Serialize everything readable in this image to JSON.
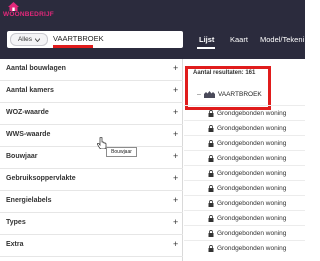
{
  "header": {
    "logo_text": "WOONBEDRIJF",
    "brand_color": "#e2287a"
  },
  "search": {
    "scope_label": "Alles",
    "query": "VAARTBROEK"
  },
  "tabs": [
    {
      "label": "Lijst",
      "active": true
    },
    {
      "label": "Kaart",
      "active": false
    },
    {
      "label": "Model/Tekeni",
      "active": false
    }
  ],
  "filters": [
    {
      "label": "Aantal bouwlagen",
      "icon": "plus-icon"
    },
    {
      "label": "Aantal kamers",
      "icon": "plus-icon"
    },
    {
      "label": "WOZ-waarde",
      "icon": "plus-icon"
    },
    {
      "label": "WWS-waarde",
      "icon": "plus-icon"
    },
    {
      "label": "Bouwjaar",
      "icon": "plus-icon"
    },
    {
      "label": "Gebruiksoppervlakte",
      "icon": "plus-icon"
    },
    {
      "label": "Energielabels",
      "icon": "plus-icon"
    },
    {
      "label": "Types",
      "icon": "plus-icon"
    },
    {
      "label": "Extra",
      "icon": "plus-icon"
    }
  ],
  "tooltip": "Bouwjaar",
  "results": {
    "count_label": "Aantal resultaten: 161",
    "group": {
      "toggle": "–",
      "label": "VAARTBROEK",
      "icon": "buildings-icon"
    },
    "items": [
      "Grondgebonden woning",
      "Grondgebonden woning",
      "Grondgebonden woning",
      "Grondgebonden woning",
      "Grondgebonden woning",
      "Grondgebonden woning",
      "Grondgebonden woning",
      "Grondgebonden woning",
      "Grondgebonden woning",
      "Grondgebonden woning"
    ]
  },
  "highlight_color": "#e01c1c"
}
